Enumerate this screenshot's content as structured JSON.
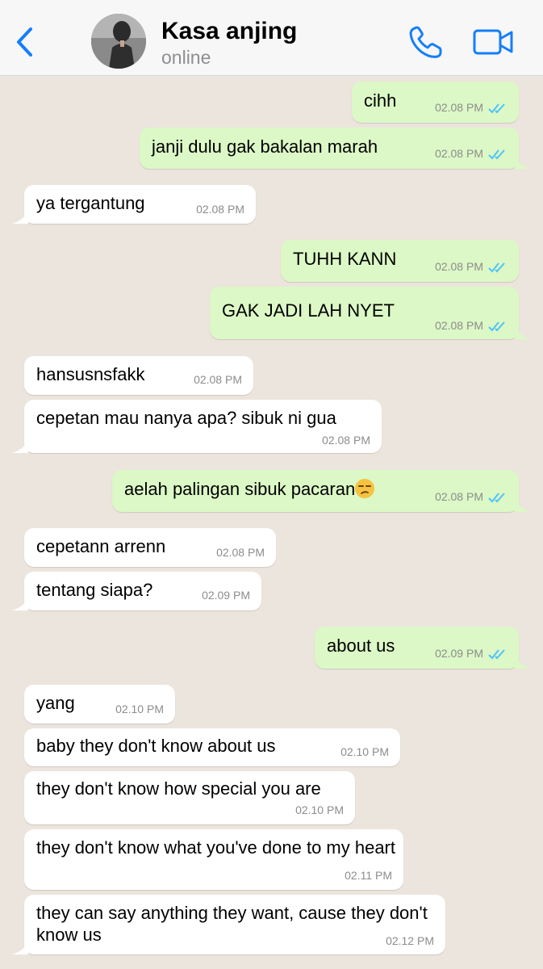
{
  "header": {
    "contact_name": "Kasa anjing",
    "contact_status": "online"
  },
  "messages": [
    {
      "dir": "out",
      "text": "cihh",
      "time": "02.08 PM"
    },
    {
      "dir": "out",
      "text": "janji dulu gak bakalan marah",
      "time": "02.08 PM"
    },
    {
      "dir": "in",
      "text": "ya tergantung",
      "time": "02.08 PM"
    },
    {
      "dir": "out",
      "text": "TUHH KANN",
      "time": "02.08 PM"
    },
    {
      "dir": "out",
      "text": "GAK JADI LAH NYET",
      "time": "02.08 PM"
    },
    {
      "dir": "in",
      "text": "hansusnsfakk",
      "time": "02.08 PM"
    },
    {
      "dir": "in",
      "text": "cepetan mau nanya apa? sibuk ni gua",
      "time": "02.08 PM"
    },
    {
      "dir": "out",
      "text": "aelah palingan sibuk pacaran",
      "time": "02.08 PM"
    },
    {
      "dir": "in",
      "text": "cepetann arrenn",
      "time": "02.08 PM"
    },
    {
      "dir": "in",
      "text": "tentang siapa?",
      "time": "02.09 PM"
    },
    {
      "dir": "out",
      "text": "about us",
      "time": "02.09 PM"
    },
    {
      "dir": "in",
      "text": "yang",
      "time": "02.10 PM"
    },
    {
      "dir": "in",
      "text": "baby they don't know about us",
      "time": "02.10 PM"
    },
    {
      "dir": "in",
      "text": "they don't know how special you are",
      "time": "02.10 PM"
    },
    {
      "dir": "in",
      "text": "they don't know what you've done to my heart",
      "time": "02.11 PM"
    },
    {
      "dir": "in",
      "text": "they can say anything they want, cause they don't know us",
      "time": "02.12 PM"
    }
  ],
  "icons": {
    "back": "chevron-left-icon",
    "call": "phone-icon",
    "video": "video-camera-icon",
    "read": "double-check-icon",
    "emoji": "unamused-face-emoji"
  },
  "colors": {
    "accent": "#157efb",
    "outgoing_bubble": "#dcf8c6",
    "incoming_bubble": "#ffffff",
    "chat_background": "#ece5dd",
    "read_tick": "#4fc3f7"
  }
}
